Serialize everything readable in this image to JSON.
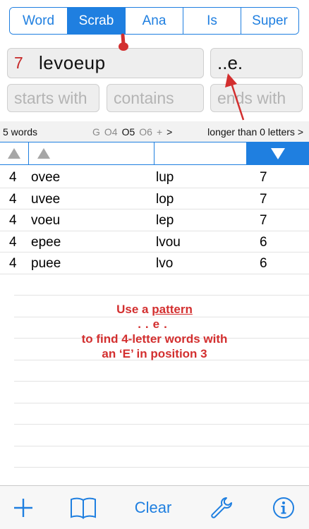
{
  "tabs": [
    {
      "label": "Word",
      "active": false
    },
    {
      "label": "Scrab",
      "active": true
    },
    {
      "label": "Ana",
      "active": false
    },
    {
      "label": "Is",
      "active": false
    },
    {
      "label": "Super",
      "active": false
    }
  ],
  "input": {
    "letter_count": "7",
    "letters": "levoeup",
    "pattern": "..e."
  },
  "filters": {
    "starts_with_placeholder": "starts with",
    "contains_placeholder": "contains",
    "ends_with_placeholder": "ends with"
  },
  "status": {
    "word_count": "5 words",
    "options": [
      "G",
      "O4",
      "O5",
      "O6",
      "+"
    ],
    "options_chevron": ">",
    "longer_than": "longer than 0 letters",
    "longer_chevron": ">"
  },
  "results": [
    {
      "length": "4",
      "word": "ovee",
      "leftover": "lup",
      "score": "7"
    },
    {
      "length": "4",
      "word": "uvee",
      "leftover": "lop",
      "score": "7"
    },
    {
      "length": "4",
      "word": "voeu",
      "leftover": "lep",
      "score": "7"
    },
    {
      "length": "4",
      "word": "epee",
      "leftover": "lvou",
      "score": "6"
    },
    {
      "length": "4",
      "word": "puee",
      "leftover": "lvo",
      "score": "6"
    }
  ],
  "annotation": {
    "line1_prefix": "Use a ",
    "line1_emph": "pattern",
    "line2": "..e.",
    "line3": "to find 4-letter words with",
    "line4": "an ‘E’ in position 3"
  },
  "toolbar": {
    "clear_label": "Clear",
    "icons": [
      "plus-icon",
      "book-icon",
      "wrench-icon",
      "info-icon"
    ]
  },
  "colors": {
    "accent": "#1f7fe0",
    "annotation": "#d32f2f",
    "count": "#c62828"
  }
}
